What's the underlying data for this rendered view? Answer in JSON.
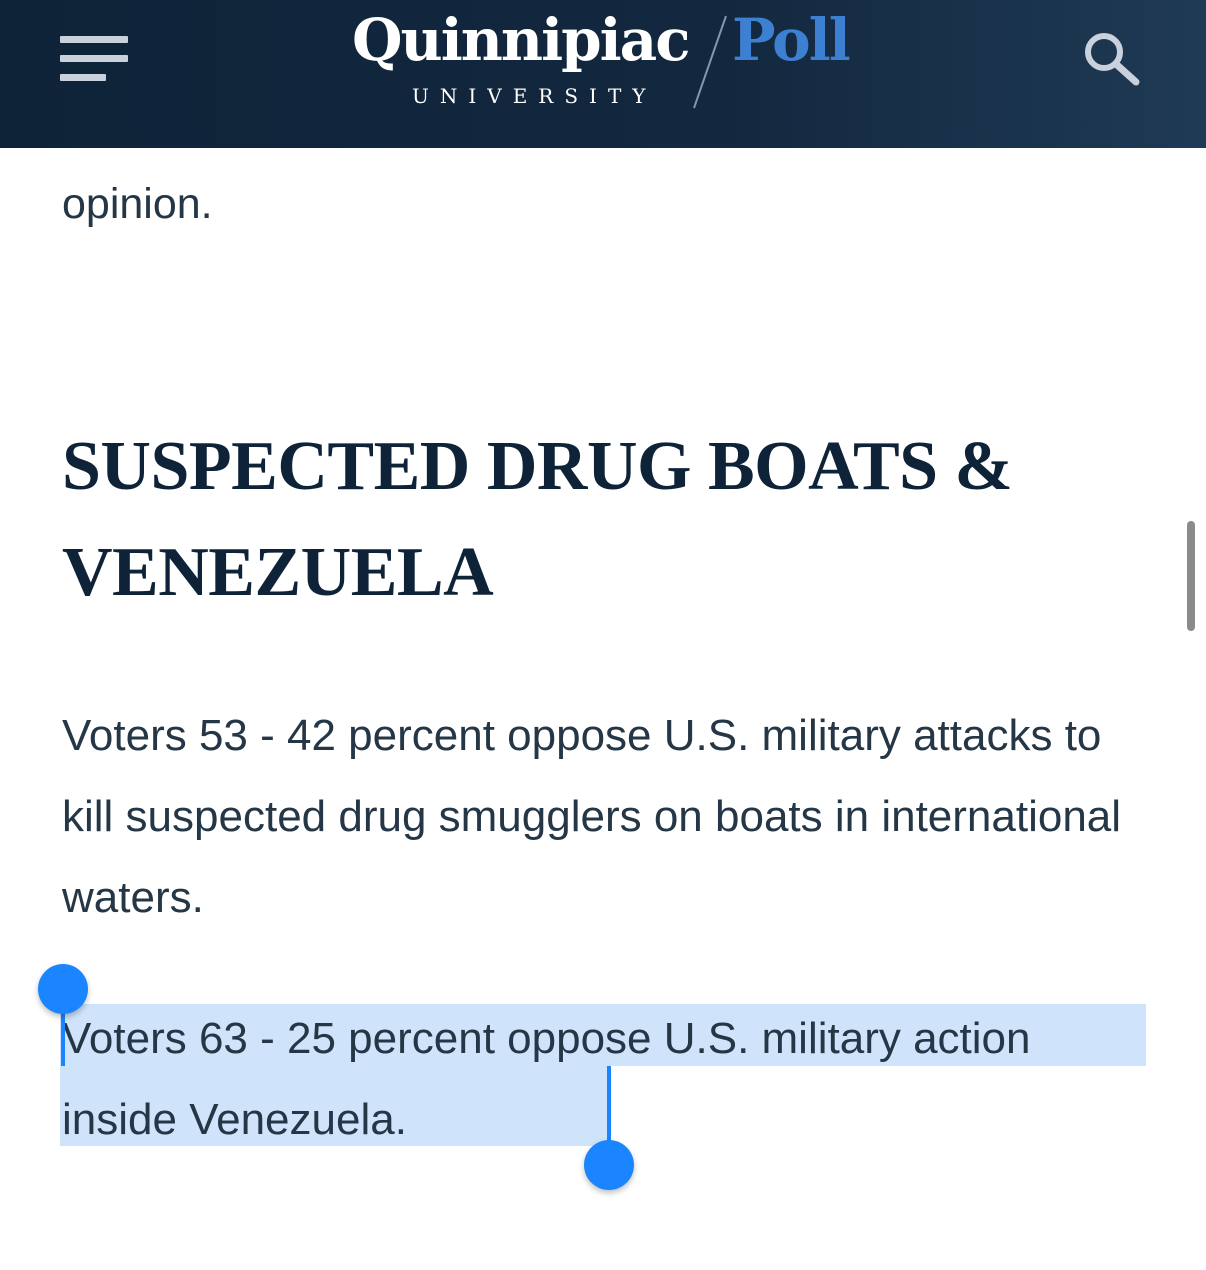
{
  "header": {
    "logo_main": "Quinnipiac",
    "logo_sub": "UNIVERSITY",
    "logo_poll": "Poll",
    "menu_icon": "hamburger-menu-icon",
    "search_icon": "search-icon",
    "colors": {
      "background": "#13283f",
      "logo_text": "#ffffff",
      "poll_text": "#3d7fd0"
    }
  },
  "article": {
    "partial_text": "opinion.",
    "heading": "SUSPECTED DRUG BOATS & VENEZUELA",
    "paragraph1": "Voters 53 - 42 percent oppose U.S. military attacks to kill suspected drug smugglers on boats in international waters.",
    "paragraph2": "Voters 63 - 25 percent oppose U.S. military action inside Venezuela."
  },
  "selection": {
    "selected_text": "Voters 63 - 25 percent oppose U.S. military action inside Venezuela.",
    "highlight_color": "#cfe3fa",
    "handle_color": "#1b84ff"
  }
}
